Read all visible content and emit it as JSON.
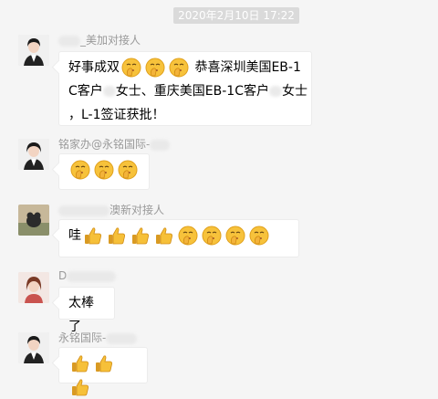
{
  "timestamp": "2020年2月10日 17:22",
  "messages": [
    {
      "sender": "_美加对接人",
      "lines": [
        "恭喜深圳美国EB-1",
        "C客户",
        "女士、重庆美国EB-1C客户",
        "女士",
        "，L-1签证获批！"
      ],
      "prefix": "好事成双",
      "emojis": [
        "shush-face",
        "shush-face",
        "shush-face"
      ]
    },
    {
      "sender": "铭家办@永铭国际-",
      "emojis": [
        "shush-face",
        "shush-face",
        "shush-face"
      ]
    },
    {
      "sender": "澳新对接人",
      "text": "哇",
      "emojis": [
        "thumbs-up",
        "thumbs-up",
        "thumbs-up",
        "thumbs-up",
        "shush-face",
        "shush-face",
        "shush-face",
        "shush-face"
      ]
    },
    {
      "sender": "D",
      "text": "太棒了"
    },
    {
      "sender": "永铭国际-",
      "emojis": [
        "thumbs-up",
        "thumbs-up",
        "thumbs-up"
      ]
    }
  ],
  "colors": {
    "bubble": "#ffffff",
    "background": "#f5f5f5",
    "sender": "#999999"
  }
}
